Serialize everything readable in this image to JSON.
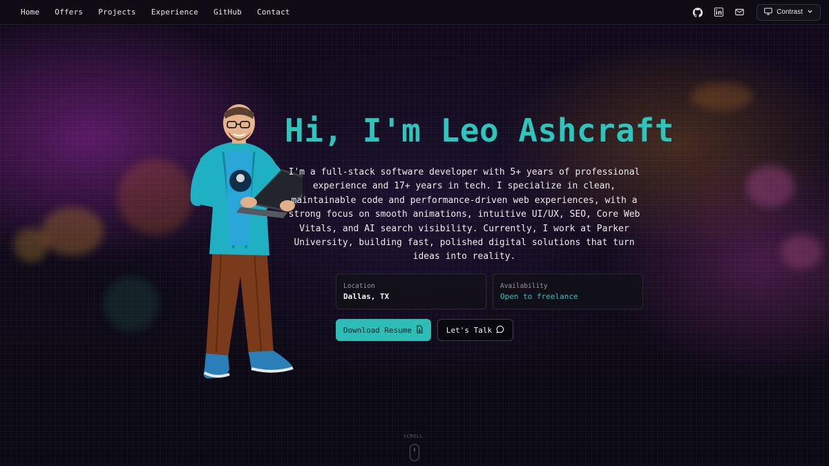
{
  "nav": {
    "links": [
      "Home",
      "Offers",
      "Projects",
      "Experience",
      "GitHub",
      "Contact"
    ],
    "icons": [
      "github-icon",
      "linkedin-icon",
      "mail-icon"
    ],
    "contrast_label": "Contrast"
  },
  "hero": {
    "title": "Hi, I'm Leo Ashcraft",
    "intro": "I'm a full-stack software developer with 5+ years of professional experience and 17+ years in tech. I specialize in clean, maintainable code and performance-driven web experiences, with a strong focus on smooth animations, intuitive UI/UX, SEO, Core Web Vitals, and AI search visibility. Currently, I work at Parker University, building fast, polished digital solutions that turn ideas into reality.",
    "location_label": "Location",
    "location_value": "Dallas, TX",
    "availability_label": "Availability",
    "availability_value": "Open to freelance",
    "download_label": "Download Resume",
    "talk_label": "Let's Talk",
    "scroll_label": "SCROLL"
  },
  "colors": {
    "accent": "#2cc6bd",
    "background": "#120a1c"
  }
}
